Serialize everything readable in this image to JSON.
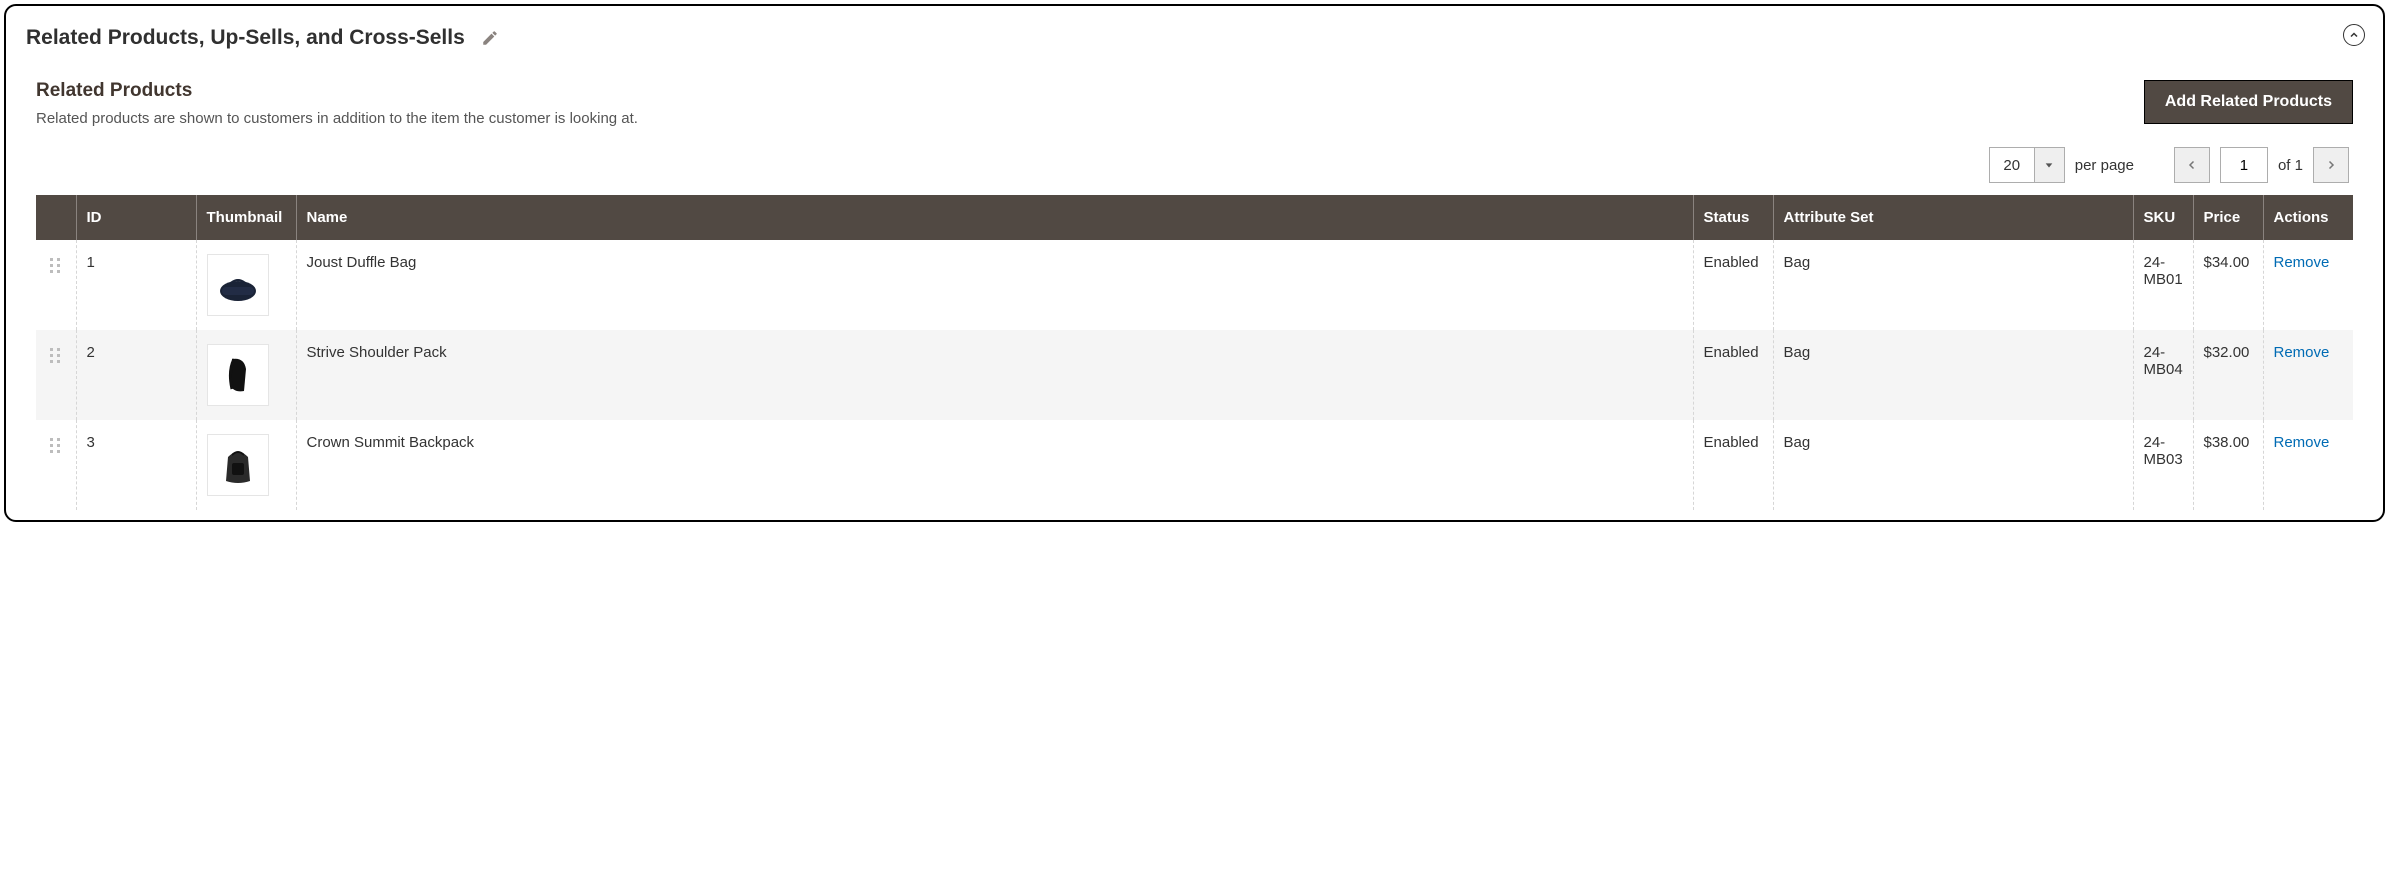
{
  "panel": {
    "title": "Related Products, Up-Sells, and Cross-Sells"
  },
  "section": {
    "title": "Related Products",
    "description": "Related products are shown to customers in addition to the item the customer is looking at.",
    "add_button": "Add Related Products"
  },
  "pager": {
    "per_page_value": "20",
    "per_page_label": "per page",
    "current_page": "1",
    "total_pages": "1",
    "of_label": "of"
  },
  "columns": {
    "handle": "",
    "id": "ID",
    "thumbnail": "Thumbnail",
    "name": "Name",
    "status": "Status",
    "attribute_set": "Attribute Set",
    "sku": "SKU",
    "price": "Price",
    "actions": "Actions"
  },
  "rows": [
    {
      "id": "1",
      "name": "Joust Duffle Bag",
      "status": "Enabled",
      "attribute_set": "Bag",
      "sku": "24-MB01",
      "price": "$34.00",
      "action": "Remove"
    },
    {
      "id": "2",
      "name": "Strive Shoulder Pack",
      "status": "Enabled",
      "attribute_set": "Bag",
      "sku": "24-MB04",
      "price": "$32.00",
      "action": "Remove"
    },
    {
      "id": "3",
      "name": "Crown Summit Backpack",
      "status": "Enabled",
      "attribute_set": "Bag",
      "sku": "24-MB03",
      "price": "$38.00",
      "action": "Remove"
    }
  ]
}
